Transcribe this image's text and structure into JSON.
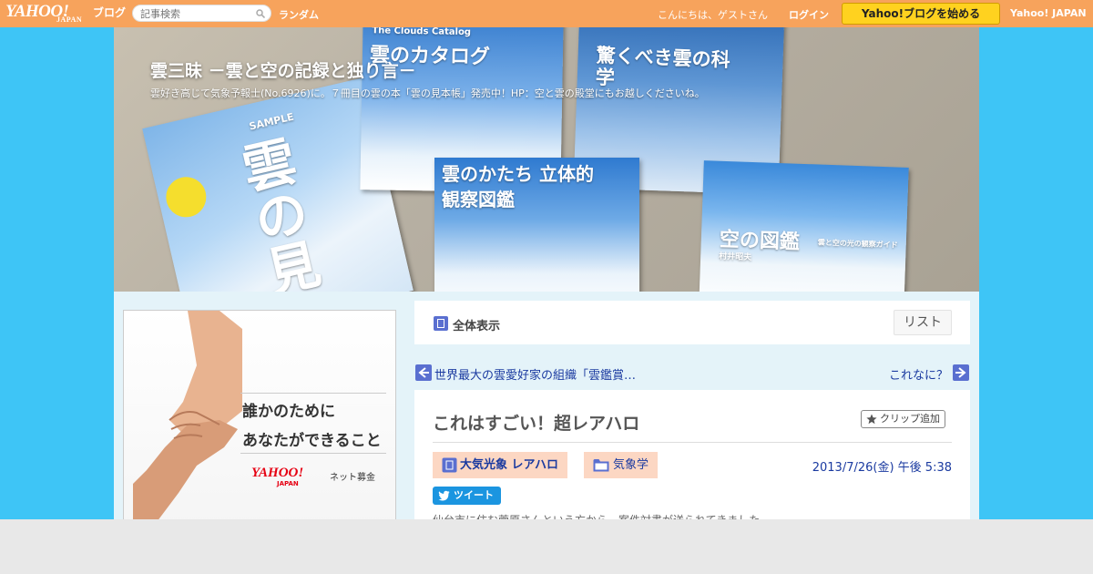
{
  "topbar": {
    "logo": "YAHOO!",
    "logo_sub": "JAPAN",
    "logo_service": "ブログ",
    "search_placeholder": "記事検索",
    "random": "ランダム",
    "greeting": "こんにちは、ゲストさん",
    "login": "ログイン",
    "start_blog": "Yahoo!ブログを始める",
    "yahoo_japan": "Yahoo! JAPAN"
  },
  "header": {
    "blog_title": "雲三昧 －雲と空の記録と独り言－",
    "blog_description": "雲好き高じて気象予報士(No.6926)に。７冊目の雲の本「雲の見本帳」発売中！HP：空と雲の殿堂にもお越しくださいね。",
    "books": {
      "b1_title": "雲の見本帳",
      "b1_label": "SAMPLE",
      "b2_title": "雲のカタログ",
      "b2_sub": "The Clouds Catalog",
      "b3_title": "驚くべき雲の科学",
      "b4_title": "雲のかたち 立体的観察図鑑",
      "b5_title": "空の図鑑",
      "b5_author": "村井昭夫",
      "b5_sub": "雲と空の光の観察ガイド"
    }
  },
  "ad": {
    "line1": "誰かのために",
    "line2": "あなたができること",
    "logo": "YAHOO!",
    "logo_sub": "JAPAN",
    "service": "ネット募金"
  },
  "main": {
    "view_all": "全体表示",
    "list_button": "リスト",
    "prev_link": "世界最大の雲愛好家の組織「雲鑑賞…",
    "next_link": "これなに？"
  },
  "article": {
    "title": "これはすごい！超レアハロ",
    "clip_button": "クリップ追加",
    "tag_primary": "大気光象 レアハロ",
    "tag_category": "気象学",
    "date": "2013/7/26(金) 午後 5:38",
    "tweet": "ツイート",
    "body_first_line": "仙台市に住む菅原さんという方から、案件対書が送られてきました。"
  },
  "colors": {
    "topbar": "#f7a35c",
    "page_bg": "#3ec5f6",
    "column_bg": "#e4f3f9",
    "link": "#1a3aa0",
    "tag_bg": "#fcd7c3",
    "start_button": "#ffd21f",
    "tweet": "#1b95e0"
  }
}
